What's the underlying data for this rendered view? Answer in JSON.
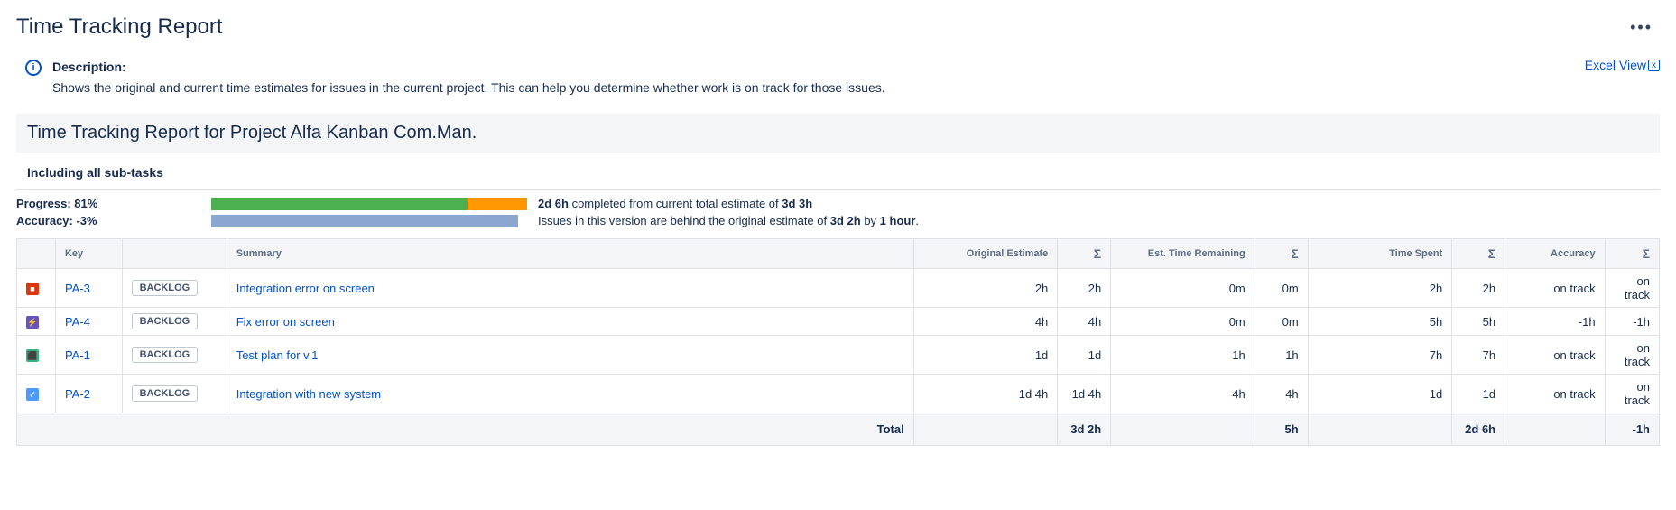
{
  "page_title": "Time Tracking Report",
  "more_label": "•••",
  "description": {
    "title": "Description:",
    "body": "Shows the original and current time estimates for issues in the current project. This can help you determine whether work is on track for those issues."
  },
  "excel_view": "Excel View",
  "report_subtitle": "Time Tracking Report for Project Alfa Kanban Com.Man.",
  "subtask_line": "Including all sub-tasks",
  "progress": {
    "label": "Progress: 81%",
    "green_pct": 81,
    "orange_pct": 19,
    "text_bold1": "2d 6h",
    "text_mid": " completed from current total estimate of ",
    "text_bold2": "3d 3h"
  },
  "accuracy": {
    "label": "Accuracy: -3%",
    "blue_pct": 97,
    "text1": "Issues in this version are behind the original estimate of ",
    "text_bold1": "3d 2h",
    "text2": " by ",
    "text_bold2": "1 hour",
    "text3": "."
  },
  "columns": {
    "key": "Key",
    "summary": "Summary",
    "orig_est": "Original Estimate",
    "sigma": "Σ",
    "est_remain": "Est. Time Remaining",
    "time_spent": "Time Spent",
    "accuracy": "Accuracy"
  },
  "rows": [
    {
      "icon_class": "ic-red",
      "icon_glyph": "■",
      "key": "PA-3",
      "status": "BACKLOG",
      "summary": "Integration error on screen",
      "orig": "2h",
      "orig_s": "2h",
      "remain": "0m",
      "remain_s": "0m",
      "spent": "2h",
      "spent_s": "2h",
      "acc": "on track",
      "acc_s": "on track"
    },
    {
      "icon_class": "ic-purple",
      "icon_glyph": "⚡",
      "key": "PA-4",
      "status": "BACKLOG",
      "summary": "Fix error on screen",
      "orig": "4h",
      "orig_s": "4h",
      "remain": "0m",
      "remain_s": "0m",
      "spent": "5h",
      "spent_s": "5h",
      "acc": "-1h",
      "acc_s": "-1h"
    },
    {
      "icon_class": "ic-green",
      "icon_glyph": "⬛",
      "key": "PA-1",
      "status": "BACKLOG",
      "summary": "Test plan for v.1",
      "orig": "1d",
      "orig_s": "1d",
      "remain": "1h",
      "remain_s": "1h",
      "spent": "7h",
      "spent_s": "7h",
      "acc": "on track",
      "acc_s": "on track"
    },
    {
      "icon_class": "ic-blue",
      "icon_glyph": "✓",
      "key": "PA-2",
      "status": "BACKLOG",
      "summary": "Integration with new system",
      "orig": "1d 4h",
      "orig_s": "1d 4h",
      "remain": "4h",
      "remain_s": "4h",
      "spent": "1d",
      "spent_s": "1d",
      "acc": "on track",
      "acc_s": "on track"
    }
  ],
  "totals": {
    "label": "Total",
    "orig_s": "3d 2h",
    "remain_s": "5h",
    "spent_s": "2d 6h",
    "acc_s": "-1h"
  }
}
